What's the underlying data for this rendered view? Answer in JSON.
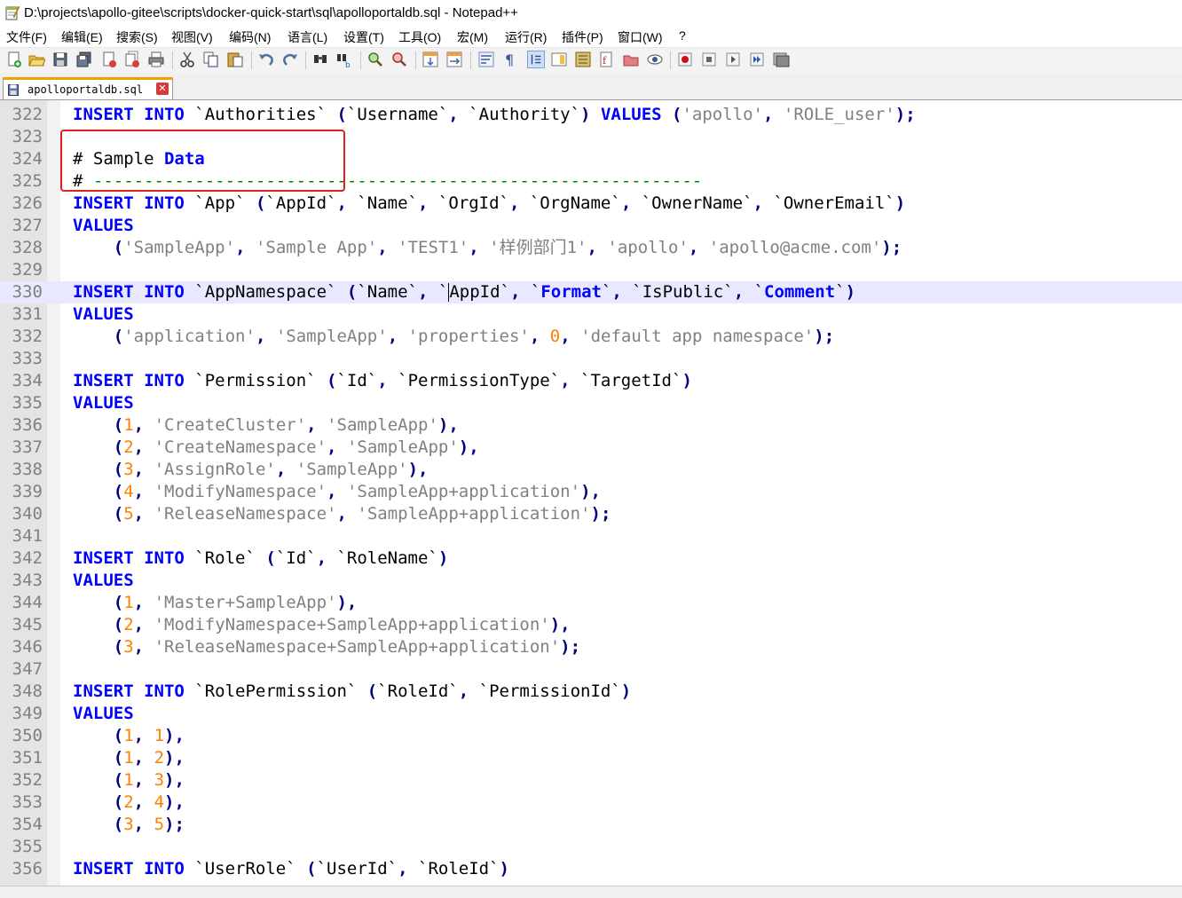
{
  "window": {
    "title": "D:\\projects\\apollo-gitee\\scripts\\docker-quick-start\\sql\\apolloportaldb.sql - Notepad++"
  },
  "menu": [
    {
      "label": "文件(F)"
    },
    {
      "label": "编辑(E)"
    },
    {
      "label": "搜索(S)"
    },
    {
      "label": "视图(V)"
    },
    {
      "label": "编码(N)"
    },
    {
      "label": "语言(L)"
    },
    {
      "label": "设置(T)"
    },
    {
      "label": "工具(O)"
    },
    {
      "label": "宏(M)"
    },
    {
      "label": "运行(R)"
    },
    {
      "label": "插件(P)"
    },
    {
      "label": "窗口(W)"
    },
    {
      "label": "?"
    }
  ],
  "toolbar": {
    "buttons": [
      "new-file-icon",
      "open-file-icon",
      "save-icon",
      "save-all-icon",
      "close-icon",
      "close-all-icon",
      "print-icon",
      "cut-icon",
      "copy-icon",
      "paste-icon",
      "undo-icon",
      "redo-icon",
      "find-icon",
      "replace-icon",
      "zoom-in-icon",
      "zoom-out-icon",
      "sync-vertical-icon",
      "sync-horizontal-icon",
      "word-wrap-icon",
      "show-all-chars-icon",
      "indent-guide-icon",
      "doc-map-icon",
      "function-list-icon",
      "folder-workspace-icon",
      "monitoring-icon",
      "record-macro-icon",
      "stop-macro-icon",
      "play-macro-icon",
      "run-macro-multiple-icon",
      "save-macro-icon"
    ]
  },
  "tab": {
    "label": "apolloportaldb.sql",
    "close": "✕"
  },
  "colors": {
    "keyword": "#0000ff",
    "string": "#808080",
    "number": "#ff8000",
    "operator": "#000080",
    "comment": "#008000",
    "current_line": "#e8e8ff",
    "highlight_box": "#e02020"
  },
  "editor": {
    "current_line": 330,
    "lines": [
      {
        "n": "322",
        "tokens": [
          [
            "kw",
            "INSERT"
          ],
          [
            "id",
            " "
          ],
          [
            "kw",
            "INTO"
          ],
          [
            "id",
            " `Authorities` "
          ],
          [
            "op",
            "("
          ],
          [
            "id",
            "`Username`"
          ],
          [
            "op",
            ","
          ],
          [
            "id",
            " `Authority`"
          ],
          [
            "op",
            ")"
          ],
          [
            "id",
            " "
          ],
          [
            "kw",
            "VALUES"
          ],
          [
            "id",
            " "
          ],
          [
            "op",
            "("
          ],
          [
            "str",
            "'apollo'"
          ],
          [
            "op",
            ","
          ],
          [
            "id",
            " "
          ],
          [
            "str",
            "'ROLE_user'"
          ],
          [
            "op",
            ");"
          ]
        ]
      },
      {
        "n": "323",
        "tokens": []
      },
      {
        "n": "324",
        "tokens": [
          [
            "id",
            "# Sample "
          ],
          [
            "kw",
            "Data"
          ]
        ]
      },
      {
        "n": "325",
        "tokens": [
          [
            "id",
            "# "
          ],
          [
            "cmt",
            "------------------------------------------------------------"
          ]
        ]
      },
      {
        "n": "326",
        "tokens": [
          [
            "kw",
            "INSERT"
          ],
          [
            "id",
            " "
          ],
          [
            "kw",
            "INTO"
          ],
          [
            "id",
            " `App` "
          ],
          [
            "op",
            "("
          ],
          [
            "id",
            "`AppId`"
          ],
          [
            "op",
            ","
          ],
          [
            "id",
            " `Name`"
          ],
          [
            "op",
            ","
          ],
          [
            "id",
            " `OrgId`"
          ],
          [
            "op",
            ","
          ],
          [
            "id",
            " `OrgName`"
          ],
          [
            "op",
            ","
          ],
          [
            "id",
            " `OwnerName`"
          ],
          [
            "op",
            ","
          ],
          [
            "id",
            " `OwnerEmail`"
          ],
          [
            "op",
            ")"
          ]
        ]
      },
      {
        "n": "327",
        "tokens": [
          [
            "kw",
            "VALUES"
          ]
        ]
      },
      {
        "n": "328",
        "tokens": [
          [
            "id",
            "    "
          ],
          [
            "op",
            "("
          ],
          [
            "str",
            "'SampleApp'"
          ],
          [
            "op",
            ","
          ],
          [
            "id",
            " "
          ],
          [
            "str",
            "'Sample App'"
          ],
          [
            "op",
            ","
          ],
          [
            "id",
            " "
          ],
          [
            "str",
            "'TEST1'"
          ],
          [
            "op",
            ","
          ],
          [
            "id",
            " "
          ],
          [
            "str",
            "'样例部门1'"
          ],
          [
            "op",
            ","
          ],
          [
            "id",
            " "
          ],
          [
            "str",
            "'apollo'"
          ],
          [
            "op",
            ","
          ],
          [
            "id",
            " "
          ],
          [
            "str",
            "'apollo@acme.com'"
          ],
          [
            "op",
            ");"
          ]
        ]
      },
      {
        "n": "329",
        "tokens": []
      },
      {
        "n": "330",
        "tokens": [
          [
            "kw",
            "INSERT"
          ],
          [
            "id",
            " "
          ],
          [
            "kw",
            "INTO"
          ],
          [
            "id",
            " `AppNamespace` "
          ],
          [
            "op",
            "("
          ],
          [
            "id",
            "`Name`"
          ],
          [
            "op",
            ","
          ],
          [
            "id",
            " `"
          ],
          [
            "cursor",
            ""
          ],
          [
            "id",
            "AppId`"
          ],
          [
            "op",
            ","
          ],
          [
            "id",
            " `"
          ],
          [
            "kw",
            "Format"
          ],
          [
            "id",
            "`"
          ],
          [
            "op",
            ","
          ],
          [
            "id",
            " `IsPublic`"
          ],
          [
            "op",
            ","
          ],
          [
            "id",
            " `"
          ],
          [
            "kw",
            "Comment"
          ],
          [
            "id",
            "`"
          ],
          [
            "op",
            ")"
          ]
        ]
      },
      {
        "n": "331",
        "tokens": [
          [
            "kw",
            "VALUES"
          ]
        ]
      },
      {
        "n": "332",
        "tokens": [
          [
            "id",
            "    "
          ],
          [
            "op",
            "("
          ],
          [
            "str",
            "'application'"
          ],
          [
            "op",
            ","
          ],
          [
            "id",
            " "
          ],
          [
            "str",
            "'SampleApp'"
          ],
          [
            "op",
            ","
          ],
          [
            "id",
            " "
          ],
          [
            "str",
            "'properties'"
          ],
          [
            "op",
            ","
          ],
          [
            "id",
            " "
          ],
          [
            "num",
            "0"
          ],
          [
            "op",
            ","
          ],
          [
            "id",
            " "
          ],
          [
            "str",
            "'default app namespace'"
          ],
          [
            "op",
            ");"
          ]
        ]
      },
      {
        "n": "333",
        "tokens": []
      },
      {
        "n": "334",
        "tokens": [
          [
            "kw",
            "INSERT"
          ],
          [
            "id",
            " "
          ],
          [
            "kw",
            "INTO"
          ],
          [
            "id",
            " `Permission` "
          ],
          [
            "op",
            "("
          ],
          [
            "id",
            "`Id`"
          ],
          [
            "op",
            ","
          ],
          [
            "id",
            " `PermissionType`"
          ],
          [
            "op",
            ","
          ],
          [
            "id",
            " `TargetId`"
          ],
          [
            "op",
            ")"
          ]
        ]
      },
      {
        "n": "335",
        "tokens": [
          [
            "kw",
            "VALUES"
          ]
        ]
      },
      {
        "n": "336",
        "tokens": [
          [
            "id",
            "    "
          ],
          [
            "op",
            "("
          ],
          [
            "num",
            "1"
          ],
          [
            "op",
            ","
          ],
          [
            "id",
            " "
          ],
          [
            "str",
            "'CreateCluster'"
          ],
          [
            "op",
            ","
          ],
          [
            "id",
            " "
          ],
          [
            "str",
            "'SampleApp'"
          ],
          [
            "op",
            "),"
          ]
        ]
      },
      {
        "n": "337",
        "tokens": [
          [
            "id",
            "    "
          ],
          [
            "op",
            "("
          ],
          [
            "num",
            "2"
          ],
          [
            "op",
            ","
          ],
          [
            "id",
            " "
          ],
          [
            "str",
            "'CreateNamespace'"
          ],
          [
            "op",
            ","
          ],
          [
            "id",
            " "
          ],
          [
            "str",
            "'SampleApp'"
          ],
          [
            "op",
            "),"
          ]
        ]
      },
      {
        "n": "338",
        "tokens": [
          [
            "id",
            "    "
          ],
          [
            "op",
            "("
          ],
          [
            "num",
            "3"
          ],
          [
            "op",
            ","
          ],
          [
            "id",
            " "
          ],
          [
            "str",
            "'AssignRole'"
          ],
          [
            "op",
            ","
          ],
          [
            "id",
            " "
          ],
          [
            "str",
            "'SampleApp'"
          ],
          [
            "op",
            "),"
          ]
        ]
      },
      {
        "n": "339",
        "tokens": [
          [
            "id",
            "    "
          ],
          [
            "op",
            "("
          ],
          [
            "num",
            "4"
          ],
          [
            "op",
            ","
          ],
          [
            "id",
            " "
          ],
          [
            "str",
            "'ModifyNamespace'"
          ],
          [
            "op",
            ","
          ],
          [
            "id",
            " "
          ],
          [
            "str",
            "'SampleApp+application'"
          ],
          [
            "op",
            "),"
          ]
        ]
      },
      {
        "n": "340",
        "tokens": [
          [
            "id",
            "    "
          ],
          [
            "op",
            "("
          ],
          [
            "num",
            "5"
          ],
          [
            "op",
            ","
          ],
          [
            "id",
            " "
          ],
          [
            "str",
            "'ReleaseNamespace'"
          ],
          [
            "op",
            ","
          ],
          [
            "id",
            " "
          ],
          [
            "str",
            "'SampleApp+application'"
          ],
          [
            "op",
            ");"
          ]
        ]
      },
      {
        "n": "341",
        "tokens": []
      },
      {
        "n": "342",
        "tokens": [
          [
            "kw",
            "INSERT"
          ],
          [
            "id",
            " "
          ],
          [
            "kw",
            "INTO"
          ],
          [
            "id",
            " `Role` "
          ],
          [
            "op",
            "("
          ],
          [
            "id",
            "`Id`"
          ],
          [
            "op",
            ","
          ],
          [
            "id",
            " `RoleName`"
          ],
          [
            "op",
            ")"
          ]
        ]
      },
      {
        "n": "343",
        "tokens": [
          [
            "kw",
            "VALUES"
          ]
        ]
      },
      {
        "n": "344",
        "tokens": [
          [
            "id",
            "    "
          ],
          [
            "op",
            "("
          ],
          [
            "num",
            "1"
          ],
          [
            "op",
            ","
          ],
          [
            "id",
            " "
          ],
          [
            "str",
            "'Master+SampleApp'"
          ],
          [
            "op",
            "),"
          ]
        ]
      },
      {
        "n": "345",
        "tokens": [
          [
            "id",
            "    "
          ],
          [
            "op",
            "("
          ],
          [
            "num",
            "2"
          ],
          [
            "op",
            ","
          ],
          [
            "id",
            " "
          ],
          [
            "str",
            "'ModifyNamespace+SampleApp+application'"
          ],
          [
            "op",
            "),"
          ]
        ]
      },
      {
        "n": "346",
        "tokens": [
          [
            "id",
            "    "
          ],
          [
            "op",
            "("
          ],
          [
            "num",
            "3"
          ],
          [
            "op",
            ","
          ],
          [
            "id",
            " "
          ],
          [
            "str",
            "'ReleaseNamespace+SampleApp+application'"
          ],
          [
            "op",
            ");"
          ]
        ]
      },
      {
        "n": "347",
        "tokens": []
      },
      {
        "n": "348",
        "tokens": [
          [
            "kw",
            "INSERT"
          ],
          [
            "id",
            " "
          ],
          [
            "kw",
            "INTO"
          ],
          [
            "id",
            " `RolePermission` "
          ],
          [
            "op",
            "("
          ],
          [
            "id",
            "`RoleId`"
          ],
          [
            "op",
            ","
          ],
          [
            "id",
            " `PermissionId`"
          ],
          [
            "op",
            ")"
          ]
        ]
      },
      {
        "n": "349",
        "tokens": [
          [
            "kw",
            "VALUES"
          ]
        ]
      },
      {
        "n": "350",
        "tokens": [
          [
            "id",
            "    "
          ],
          [
            "op",
            "("
          ],
          [
            "num",
            "1"
          ],
          [
            "op",
            ","
          ],
          [
            "id",
            " "
          ],
          [
            "num",
            "1"
          ],
          [
            "op",
            "),"
          ]
        ]
      },
      {
        "n": "351",
        "tokens": [
          [
            "id",
            "    "
          ],
          [
            "op",
            "("
          ],
          [
            "num",
            "1"
          ],
          [
            "op",
            ","
          ],
          [
            "id",
            " "
          ],
          [
            "num",
            "2"
          ],
          [
            "op",
            "),"
          ]
        ]
      },
      {
        "n": "352",
        "tokens": [
          [
            "id",
            "    "
          ],
          [
            "op",
            "("
          ],
          [
            "num",
            "1"
          ],
          [
            "op",
            ","
          ],
          [
            "id",
            " "
          ],
          [
            "num",
            "3"
          ],
          [
            "op",
            "),"
          ]
        ]
      },
      {
        "n": "353",
        "tokens": [
          [
            "id",
            "    "
          ],
          [
            "op",
            "("
          ],
          [
            "num",
            "2"
          ],
          [
            "op",
            ","
          ],
          [
            "id",
            " "
          ],
          [
            "num",
            "4"
          ],
          [
            "op",
            "),"
          ]
        ]
      },
      {
        "n": "354",
        "tokens": [
          [
            "id",
            "    "
          ],
          [
            "op",
            "("
          ],
          [
            "num",
            "3"
          ],
          [
            "op",
            ","
          ],
          [
            "id",
            " "
          ],
          [
            "num",
            "5"
          ],
          [
            "op",
            ");"
          ]
        ]
      },
      {
        "n": "355",
        "tokens": []
      },
      {
        "n": "356",
        "tokens": [
          [
            "kw",
            "INSERT"
          ],
          [
            "id",
            " "
          ],
          [
            "kw",
            "INTO"
          ],
          [
            "id",
            " `UserRole` "
          ],
          [
            "op",
            "("
          ],
          [
            "id",
            "`UserId`"
          ],
          [
            "op",
            ","
          ],
          [
            "id",
            " `RoleId`"
          ],
          [
            "op",
            ")"
          ]
        ]
      }
    ]
  }
}
